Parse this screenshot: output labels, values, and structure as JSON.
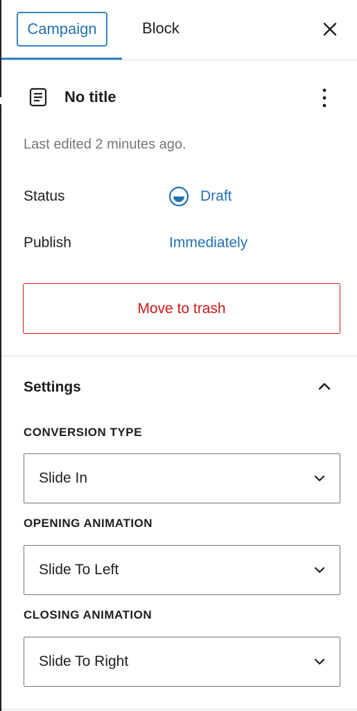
{
  "tabs": {
    "campaign_label": "Campaign",
    "block_label": "Block",
    "close_icon": "close-icon"
  },
  "summary": {
    "title": "No title",
    "title_icon": "document-icon",
    "more_icon": "more-vertical-icon",
    "last_edited": "Last edited 2 minutes ago.",
    "status_label": "Status",
    "status_value": "Draft",
    "status_icon": "draft-status-icon",
    "publish_label": "Publish",
    "publish_value": "Immediately",
    "trash_label": "Move to trash"
  },
  "settings": {
    "title": "Settings",
    "collapse_icon": "chevron-up-icon",
    "fields": [
      {
        "label": "CONVERSION TYPE",
        "value": "Slide In"
      },
      {
        "label": "OPENING ANIMATION",
        "value": "Slide To Left"
      },
      {
        "label": "CLOSING ANIMATION",
        "value": "Slide To Right"
      }
    ]
  },
  "colors": {
    "accent": "#2271b1",
    "danger": "#cc1818",
    "text": "#1e1e1e",
    "muted": "#757575",
    "divider": "#dcdcde"
  }
}
